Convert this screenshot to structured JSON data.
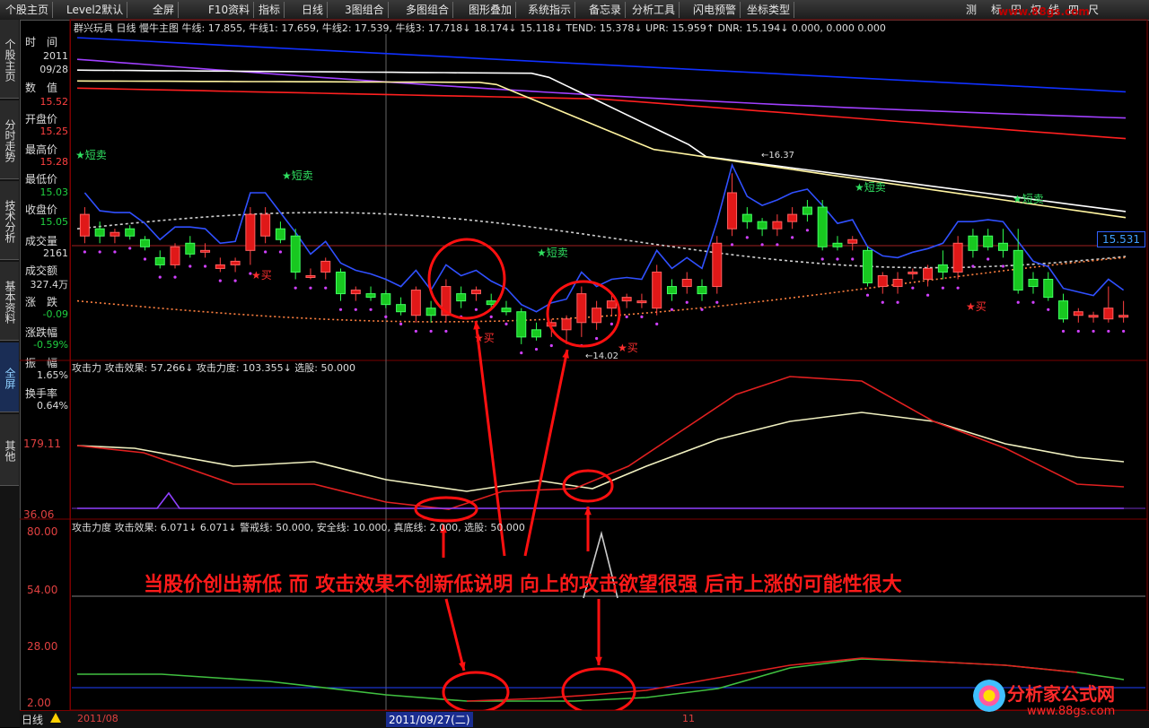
{
  "toolbar": {
    "items": [
      "个股主页",
      "Level2默认",
      "全屏",
      "F10资料",
      "指标",
      "日线",
      "3图组合",
      "多图组合",
      "图形叠加",
      "系统指示",
      "备忘录",
      "分析工具",
      "闪电预警",
      "坐标类型"
    ],
    "right": [
      "测",
      "标",
      "田",
      "权",
      "线",
      "四",
      "尺"
    ]
  },
  "watermark_logo": "www.88gs.com",
  "sidebar": {
    "tabs": [
      "个股主页",
      "分时走势",
      "技术分析",
      "基本资料",
      "全屏",
      "其他"
    ],
    "active": 4
  },
  "info_panel": {
    "time_label": "时　间",
    "year": "2011",
    "date": "09/28",
    "value_label": "数　值",
    "value": "15.52",
    "open_label": "开盘价",
    "open": "15.25",
    "high_label": "最高价",
    "high": "15.28",
    "low_label": "最低价",
    "low": "15.03",
    "close_label": "收盘价",
    "close": "15.05",
    "volume_label": "成交量",
    "volume": "2161",
    "amount_label": "成交额",
    "amount": "327.4万",
    "change_label": "涨　跌",
    "change": "-0.09",
    "change_pct_label": "涨跌幅",
    "change_pct": "-0.59%",
    "amplitude_label": "振　幅",
    "amplitude": "1.65%",
    "turnover_label": "换手率",
    "turnover": "0.64%"
  },
  "main_chart": {
    "header": "群兴玩具 日线 慢牛主图 牛线: 17.855, 牛线1: 17.659, 牛线2: 17.539, 牛线3: 17.718↓ 18.174↓ 15.118↓ TEND: 15.378↓ UPR: 15.959↑ DNR: 15.194↓ 0.000, 0.000 0.000",
    "price_tag": "15.531",
    "high_marker": "16.37",
    "low_marker": "14.02",
    "sell_signal": "★短卖",
    "buy_signal": "★买",
    "price_range": [
      13.8,
      18.3
    ],
    "candles": [
      [
        15.5,
        15.9,
        15.4,
        15.8
      ],
      [
        15.6,
        15.7,
        15.4,
        15.5
      ],
      [
        15.5,
        15.6,
        15.4,
        15.55
      ],
      [
        15.6,
        15.65,
        15.45,
        15.5
      ],
      [
        15.45,
        15.5,
        15.3,
        15.35
      ],
      [
        15.2,
        15.3,
        15.05,
        15.1
      ],
      [
        15.1,
        15.4,
        15.05,
        15.35
      ],
      [
        15.4,
        15.5,
        15.2,
        15.25
      ],
      [
        15.3,
        15.4,
        15.2,
        15.3
      ],
      [
        15.05,
        15.2,
        15.0,
        15.1
      ],
      [
        15.1,
        15.2,
        15.0,
        15.15
      ],
      [
        15.3,
        15.9,
        15.1,
        15.8
      ],
      [
        15.5,
        15.9,
        15.4,
        15.8
      ],
      [
        15.6,
        15.7,
        15.4,
        15.45
      ],
      [
        15.5,
        15.6,
        14.9,
        15.0
      ],
      [
        14.95,
        15.05,
        14.9,
        14.95
      ],
      [
        15.0,
        15.2,
        14.9,
        15.15
      ],
      [
        15.0,
        15.05,
        14.6,
        14.7
      ],
      [
        14.7,
        14.8,
        14.6,
        14.75
      ],
      [
        14.7,
        14.8,
        14.6,
        14.65
      ],
      [
        14.7,
        14.75,
        14.5,
        14.55
      ],
      [
        14.55,
        14.65,
        14.4,
        14.45
      ],
      [
        14.4,
        14.8,
        14.3,
        14.75
      ],
      [
        14.5,
        14.6,
        14.3,
        14.4
      ],
      [
        14.4,
        14.9,
        14.3,
        14.8
      ],
      [
        14.7,
        14.8,
        14.5,
        14.6
      ],
      [
        14.7,
        14.8,
        14.6,
        14.75
      ],
      [
        14.6,
        14.7,
        14.5,
        14.55
      ],
      [
        14.5,
        14.6,
        14.4,
        14.45
      ],
      [
        14.45,
        14.5,
        14.0,
        14.1
      ],
      [
        14.2,
        14.3,
        14.05,
        14.1
      ],
      [
        14.25,
        14.35,
        14.1,
        14.3
      ],
      [
        14.2,
        14.4,
        14.0,
        14.35
      ],
      [
        14.3,
        14.8,
        14.1,
        14.7
      ],
      [
        14.3,
        14.6,
        14.2,
        14.5
      ],
      [
        14.5,
        14.7,
        14.4,
        14.6
      ],
      [
        14.6,
        14.7,
        14.5,
        14.65
      ],
      [
        14.6,
        14.7,
        14.5,
        14.6
      ],
      [
        14.5,
        15.1,
        14.4,
        15.0
      ],
      [
        14.8,
        14.9,
        14.6,
        14.7
      ],
      [
        14.8,
        15.0,
        14.7,
        14.9
      ],
      [
        14.8,
        14.9,
        14.6,
        14.7
      ],
      [
        14.8,
        15.5,
        14.7,
        15.4
      ],
      [
        15.6,
        16.37,
        15.5,
        16.1
      ],
      [
        15.8,
        15.9,
        15.6,
        15.7
      ],
      [
        15.7,
        15.75,
        15.5,
        15.6
      ],
      [
        15.6,
        15.8,
        15.5,
        15.7
      ],
      [
        15.7,
        15.9,
        15.6,
        15.8
      ],
      [
        15.9,
        16.0,
        15.7,
        15.8
      ],
      [
        15.9,
        16.0,
        15.3,
        15.35
      ],
      [
        15.4,
        15.5,
        15.3,
        15.35
      ],
      [
        15.4,
        15.5,
        15.3,
        15.45
      ],
      [
        15.3,
        15.35,
        14.8,
        14.85
      ],
      [
        14.8,
        15.0,
        14.7,
        14.95
      ],
      [
        14.8,
        15.0,
        14.7,
        14.9
      ],
      [
        15.0,
        15.05,
        14.9,
        15.0
      ],
      [
        14.9,
        15.1,
        14.8,
        15.05
      ],
      [
        15.1,
        15.3,
        14.9,
        15.0
      ],
      [
        15.0,
        15.5,
        14.9,
        15.4
      ],
      [
        15.5,
        15.6,
        15.2,
        15.3
      ],
      [
        15.5,
        15.6,
        15.3,
        15.35
      ],
      [
        15.4,
        15.6,
        15.2,
        15.3
      ],
      [
        15.3,
        15.6,
        14.7,
        14.75
      ],
      [
        14.9,
        15.0,
        14.7,
        14.8
      ],
      [
        14.9,
        15.0,
        14.6,
        14.65
      ],
      [
        14.6,
        14.7,
        14.3,
        14.35
      ],
      [
        14.4,
        14.5,
        14.3,
        14.45
      ],
      [
        14.4,
        14.45,
        14.3,
        14.4
      ],
      [
        14.35,
        14.8,
        14.3,
        14.5
      ],
      [
        14.4,
        14.6,
        14.3,
        14.4
      ]
    ]
  },
  "indicator1": {
    "header": "攻击力 攻击效果: 57.266↓ 攻击力度: 103.355↓ 选股: 50.000",
    "label_top": "179.11",
    "label_bottom": "36.06"
  },
  "indicator2": {
    "header": "攻击力度 攻击效果: 6.071↓ 6.071↓ 警戒线: 50.000, 安全线: 10.000, 真底线: 2.000, 选股: 50.000",
    "labels": [
      "80.00",
      "54.00",
      "28.00",
      "2.00"
    ]
  },
  "annotation": "当股价创出新低 而 攻击效果不创新低说明 向上的攻击欲望很强 后市上涨的可能性很大",
  "bottom": {
    "period": "日线",
    "date_left": "2011/08",
    "cursor_date": "2011/09/27(二)",
    "date_right": "11"
  },
  "brand": {
    "name": "分析家公式网",
    "url": "www.88gs.com"
  },
  "colors": {
    "up": "#ff2020",
    "down": "#10d020",
    "panel_border": "#7a0000",
    "accent": "#3060ff"
  }
}
